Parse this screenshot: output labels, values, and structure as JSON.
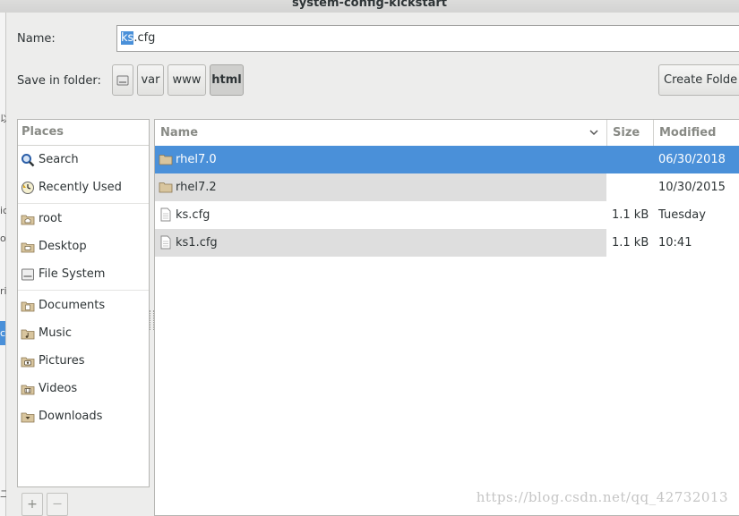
{
  "window": {
    "title": "system-config-kickstart"
  },
  "background_window": {
    "glyphs": [
      "以",
      "ic",
      "o",
      "ri",
      "c",
      "二"
    ]
  },
  "name_field": {
    "label": "Name:",
    "value_selected": "ks",
    "value_rest": ".cfg"
  },
  "save_in": {
    "label": "Save in folder:",
    "path": [
      "var",
      "www",
      "html"
    ],
    "active": "html",
    "create_folder_label": "Create Folde"
  },
  "places": {
    "header": "Places",
    "items": [
      {
        "label": "Search",
        "icon": "search-icon"
      },
      {
        "label": "Recently Used",
        "icon": "clock-icon"
      },
      {
        "label": "root",
        "icon": "home-folder-icon"
      },
      {
        "label": "Desktop",
        "icon": "desktop-folder-icon"
      },
      {
        "label": "File System",
        "icon": "drive-icon"
      },
      {
        "label": "Documents",
        "icon": "documents-folder-icon"
      },
      {
        "label": "Music",
        "icon": "music-folder-icon"
      },
      {
        "label": "Pictures",
        "icon": "pictures-folder-icon"
      },
      {
        "label": "Videos",
        "icon": "videos-folder-icon"
      },
      {
        "label": "Downloads",
        "icon": "downloads-folder-icon"
      }
    ],
    "add_label": "+",
    "remove_label": "—"
  },
  "files": {
    "columns": {
      "name": "Name",
      "size": "Size",
      "modified": "Modified"
    },
    "rows": [
      {
        "name": "rhel7.0",
        "size": "",
        "modified": "06/30/2018",
        "type": "folder",
        "selected": true
      },
      {
        "name": "rhel7.2",
        "size": "",
        "modified": "10/30/2015",
        "type": "folder",
        "selected": false
      },
      {
        "name": "ks.cfg",
        "size": "1.1 kB",
        "modified": "Tuesday",
        "type": "file",
        "selected": false
      },
      {
        "name": "ks1.cfg",
        "size": "1.1 kB",
        "modified": "10:41",
        "type": "file",
        "selected": false
      }
    ]
  },
  "watermark": "https://blog.csdn.net/qq_42732013",
  "colors": {
    "selection": "#4a90d9",
    "folder": "#c9b48d"
  }
}
